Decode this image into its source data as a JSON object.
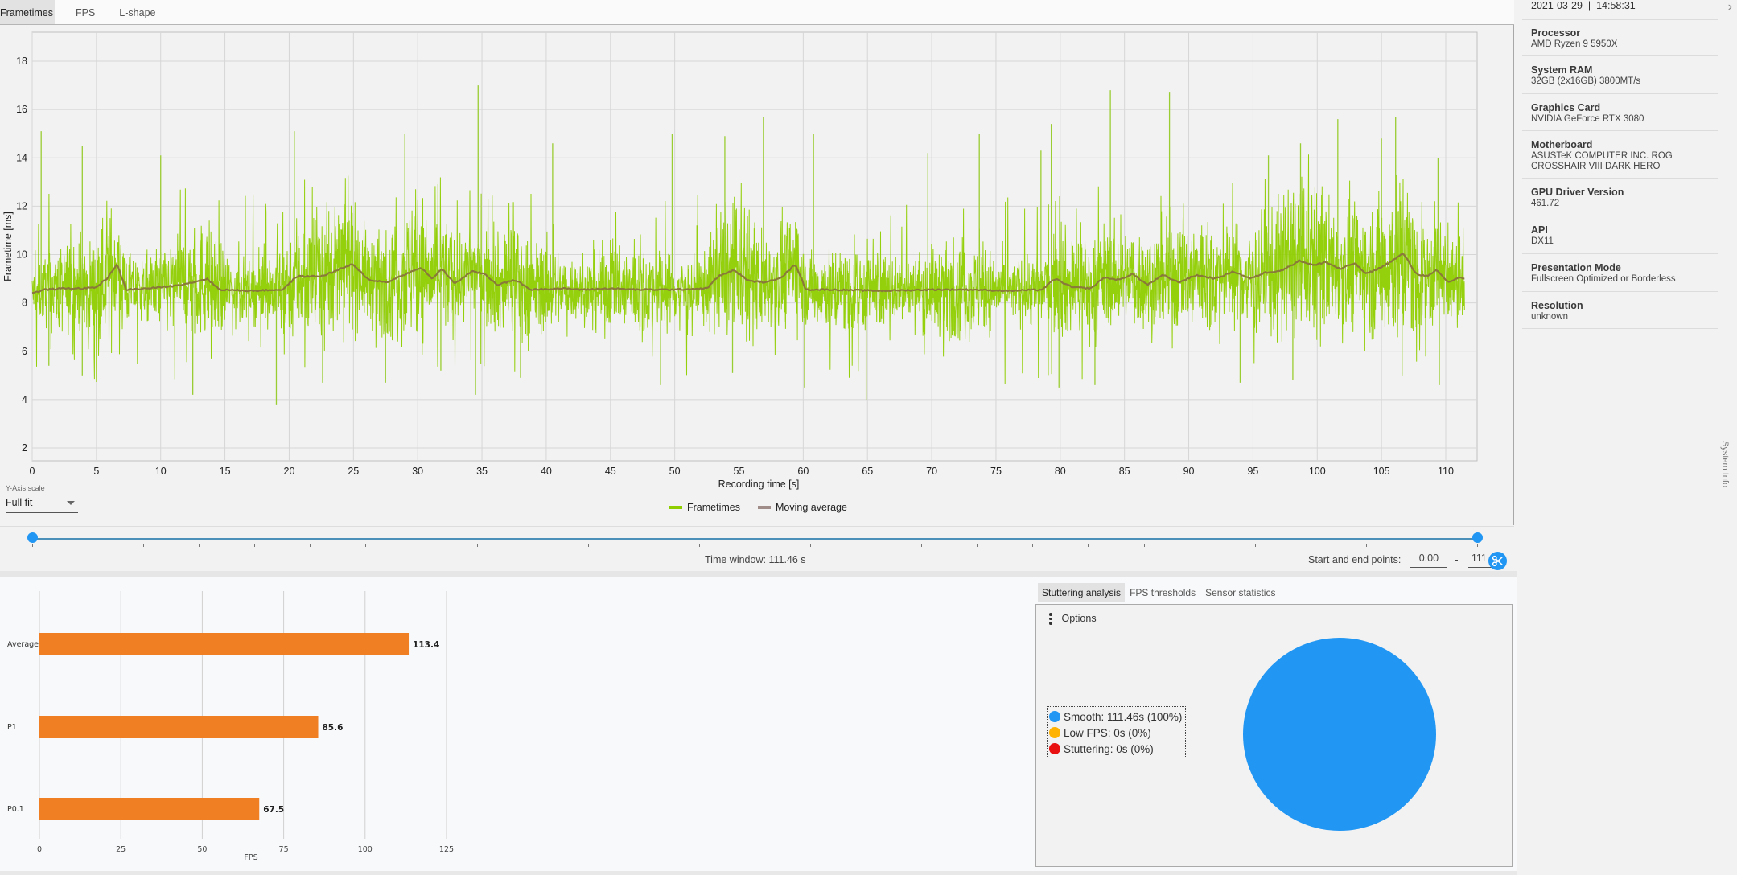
{
  "top_tabs": [
    {
      "label": "Frametimes",
      "active": true
    },
    {
      "label": "FPS",
      "active": false
    },
    {
      "label": "L-shape",
      "active": false
    }
  ],
  "frametime_chart": {
    "y_axis_scale_label": "Y-Axis scale",
    "y_axis_scale_value": "Full fit",
    "legend": [
      {
        "label": "Frametimes",
        "color": "#8fce00"
      },
      {
        "label": "Moving average",
        "color": "#a08c88"
      }
    ]
  },
  "chart_data": [
    {
      "type": "line",
      "title": "",
      "xlabel": "Recording time [s]",
      "ylabel": "Frametime [ms]",
      "xlim": [
        0,
        111.46
      ],
      "ylim": [
        1.5,
        19.2
      ],
      "xticks": [
        0,
        5,
        10,
        15,
        20,
        25,
        30,
        35,
        40,
        45,
        50,
        55,
        60,
        65,
        70,
        75,
        80,
        85,
        90,
        95,
        100,
        105,
        110
      ],
      "yticks": [
        2,
        4,
        6,
        8,
        10,
        12,
        14,
        16,
        18
      ],
      "grid": true,
      "legend_position": "bottom-center",
      "series": [
        {
          "name": "Frametimes",
          "color": "#8fce00",
          "note": "dense per-frame trace (~12,600 samples); baseline follows moving average with typical band 7.5-10.5 ms",
          "avg_fps": 113.4,
          "spikes_high": [
            [
              0.7,
              15.1
            ],
            [
              3.9,
              14.5
            ],
            [
              10.0,
              14.1
            ],
            [
              20.4,
              15.1
            ],
            [
              29.0,
              15.0
            ],
            [
              34.7,
              17.0
            ],
            [
              40.5,
              14.6
            ],
            [
              49.8,
              15.0
            ],
            [
              53.9,
              14.9
            ],
            [
              56.9,
              15.7
            ],
            [
              60.8,
              15.0
            ],
            [
              69.7,
              14.2
            ],
            [
              73.7,
              15.0
            ],
            [
              78.5,
              14.3
            ],
            [
              79.3,
              15.4
            ],
            [
              83.9,
              16.8
            ],
            [
              88.5,
              16.7
            ],
            [
              96.2,
              14.1
            ],
            [
              98.7,
              14.6
            ],
            [
              101.6,
              15.6
            ],
            [
              105.0,
              14.8
            ],
            [
              106.1,
              15.7
            ],
            [
              109.4,
              14.0
            ]
          ],
          "spikes_low": [
            [
              1.3,
              5.4
            ],
            [
              3.9,
              5.0
            ],
            [
              12.5,
              4.2
            ],
            [
              19.0,
              3.8
            ],
            [
              22.6,
              4.7
            ],
            [
              27.5,
              4.7
            ],
            [
              31.8,
              5.2
            ],
            [
              34.5,
              4.2
            ],
            [
              38.0,
              4.9
            ],
            [
              48.9,
              4.6
            ],
            [
              54.5,
              5.1
            ],
            [
              60.1,
              4.5
            ],
            [
              64.9,
              4.0
            ],
            [
              79.9,
              4.5
            ],
            [
              82.7,
              4.6
            ],
            [
              94.0,
              4.7
            ],
            [
              98.1,
              4.8
            ],
            [
              106.6,
              5.0
            ],
            [
              109.5,
              4.6
            ]
          ]
        },
        {
          "name": "Moving average",
          "color": "#8a7a3a",
          "points": [
            [
              0,
              8.4
            ],
            [
              1,
              8.55
            ],
            [
              2.5,
              8.6
            ],
            [
              4,
              8.6
            ],
            [
              5,
              8.65
            ],
            [
              5.8,
              9.0
            ],
            [
              6.6,
              9.6
            ],
            [
              7.3,
              8.55
            ],
            [
              9,
              8.6
            ],
            [
              11,
              8.7
            ],
            [
              12.5,
              8.85
            ],
            [
              13.6,
              9.0
            ],
            [
              14.6,
              8.55
            ],
            [
              17,
              8.5
            ],
            [
              19.5,
              8.55
            ],
            [
              20.6,
              9.1
            ],
            [
              22.5,
              9.1
            ],
            [
              23.5,
              9.3
            ],
            [
              24.9,
              9.6
            ],
            [
              26.2,
              8.95
            ],
            [
              27.6,
              8.85
            ],
            [
              29.1,
              9.2
            ],
            [
              30.3,
              9.45
            ],
            [
              31.1,
              9.0
            ],
            [
              31.9,
              9.4
            ],
            [
              32.9,
              8.8
            ],
            [
              34.2,
              9.3
            ],
            [
              35.2,
              9.2
            ],
            [
              36.2,
              8.75
            ],
            [
              37.6,
              8.95
            ],
            [
              38.8,
              8.55
            ],
            [
              41,
              8.6
            ],
            [
              43,
              8.55
            ],
            [
              45,
              8.6
            ],
            [
              47,
              8.55
            ],
            [
              50,
              8.55
            ],
            [
              52.5,
              8.6
            ],
            [
              53.4,
              9.1
            ],
            [
              54.6,
              9.35
            ],
            [
              55.8,
              8.9
            ],
            [
              57.2,
              8.85
            ],
            [
              58.4,
              9.1
            ],
            [
              59.4,
              9.6
            ],
            [
              60.2,
              8.55
            ],
            [
              62,
              8.55
            ],
            [
              66,
              8.5
            ],
            [
              70,
              8.55
            ],
            [
              73,
              8.55
            ],
            [
              76,
              8.5
            ],
            [
              78.6,
              8.55
            ],
            [
              79.6,
              9.0
            ],
            [
              80.9,
              8.65
            ],
            [
              82.4,
              8.6
            ],
            [
              83.4,
              9.05
            ],
            [
              84.6,
              8.95
            ],
            [
              85.6,
              9.2
            ],
            [
              86.8,
              8.75
            ],
            [
              88.0,
              9.15
            ],
            [
              89.2,
              8.85
            ],
            [
              90.6,
              9.15
            ],
            [
              92.1,
              9.0
            ],
            [
              93.5,
              9.3
            ],
            [
              94.8,
              9.0
            ],
            [
              95.9,
              9.25
            ],
            [
              97.3,
              9.35
            ],
            [
              98.6,
              9.75
            ],
            [
              99.8,
              9.55
            ],
            [
              100.6,
              9.7
            ],
            [
              101.8,
              9.4
            ],
            [
              102.9,
              9.65
            ],
            [
              103.8,
              9.2
            ],
            [
              104.9,
              9.45
            ],
            [
              106.0,
              9.8
            ],
            [
              106.7,
              10.05
            ],
            [
              107.7,
              9.2
            ],
            [
              108.6,
              9.1
            ],
            [
              109.3,
              9.35
            ],
            [
              110.2,
              8.85
            ],
            [
              111.0,
              9.05
            ],
            [
              111.46,
              9.0
            ]
          ]
        }
      ]
    },
    {
      "type": "bar",
      "orientation": "horizontal",
      "title": "",
      "xlabel": "FPS",
      "ylabel": "",
      "categories": [
        "Average",
        "P1",
        "P0.1"
      ],
      "values": [
        113.4,
        85.6,
        67.5
      ],
      "value_labels": [
        "113.4",
        "85.6",
        "67.5"
      ],
      "xlim": [
        0,
        125
      ],
      "xticks": [
        0,
        25,
        50,
        75,
        100,
        125
      ],
      "bar_color": "#f07f23",
      "grid": true
    },
    {
      "type": "pie",
      "title": "",
      "categories": [
        "Smooth",
        "Low FPS",
        "Stuttering"
      ],
      "values": [
        111.46,
        0,
        0
      ],
      "percents": [
        100,
        0,
        0
      ],
      "colors": [
        "#2196f3",
        "#ffb300",
        "#e81010"
      ],
      "legend_position": "left"
    }
  ],
  "range": {
    "time_window_label": "Time window:",
    "time_window_value": "111.46 s",
    "start_end_label": "Start and end points:",
    "start_value": "0.00",
    "separator": "-",
    "end_value": "111.46",
    "start_fraction": 0,
    "end_fraction": 1,
    "cut_icon": "scissors-icon"
  },
  "analysis": {
    "tabs": [
      {
        "label": "Stuttering analysis",
        "active": true
      },
      {
        "label": "FPS thresholds",
        "active": false
      },
      {
        "label": "Sensor statistics",
        "active": false
      }
    ],
    "options_label": "Options",
    "legend": [
      {
        "label": "Smooth:  111.46s (100%)",
        "color": "#2196f3"
      },
      {
        "label": "Low FPS:  0s (0%)",
        "color": "#ffb300"
      },
      {
        "label": "Stuttering:  0s (0%)",
        "color": "#e81010"
      }
    ]
  },
  "system_info": {
    "header": "2021-03-29  |  14:58:31",
    "side_label": "System Info",
    "items": [
      {
        "label": "Processor",
        "value": "AMD Ryzen 9 5950X"
      },
      {
        "label": "System RAM",
        "value": "32GB (2x16GB) 3800MT/s"
      },
      {
        "label": "Graphics Card",
        "value": "NVIDIA GeForce RTX 3080"
      },
      {
        "label": "Motherboard",
        "value": "ASUSTeK COMPUTER INC. ROG\nCROSSHAIR VIII DARK HERO"
      },
      {
        "label": "GPU Driver Version",
        "value": "461.72"
      },
      {
        "label": "API",
        "value": "DX11"
      },
      {
        "label": "Presentation Mode",
        "value": "Fullscreen Optimized or Borderless"
      },
      {
        "label": "Resolution",
        "value": "unknown"
      }
    ]
  }
}
